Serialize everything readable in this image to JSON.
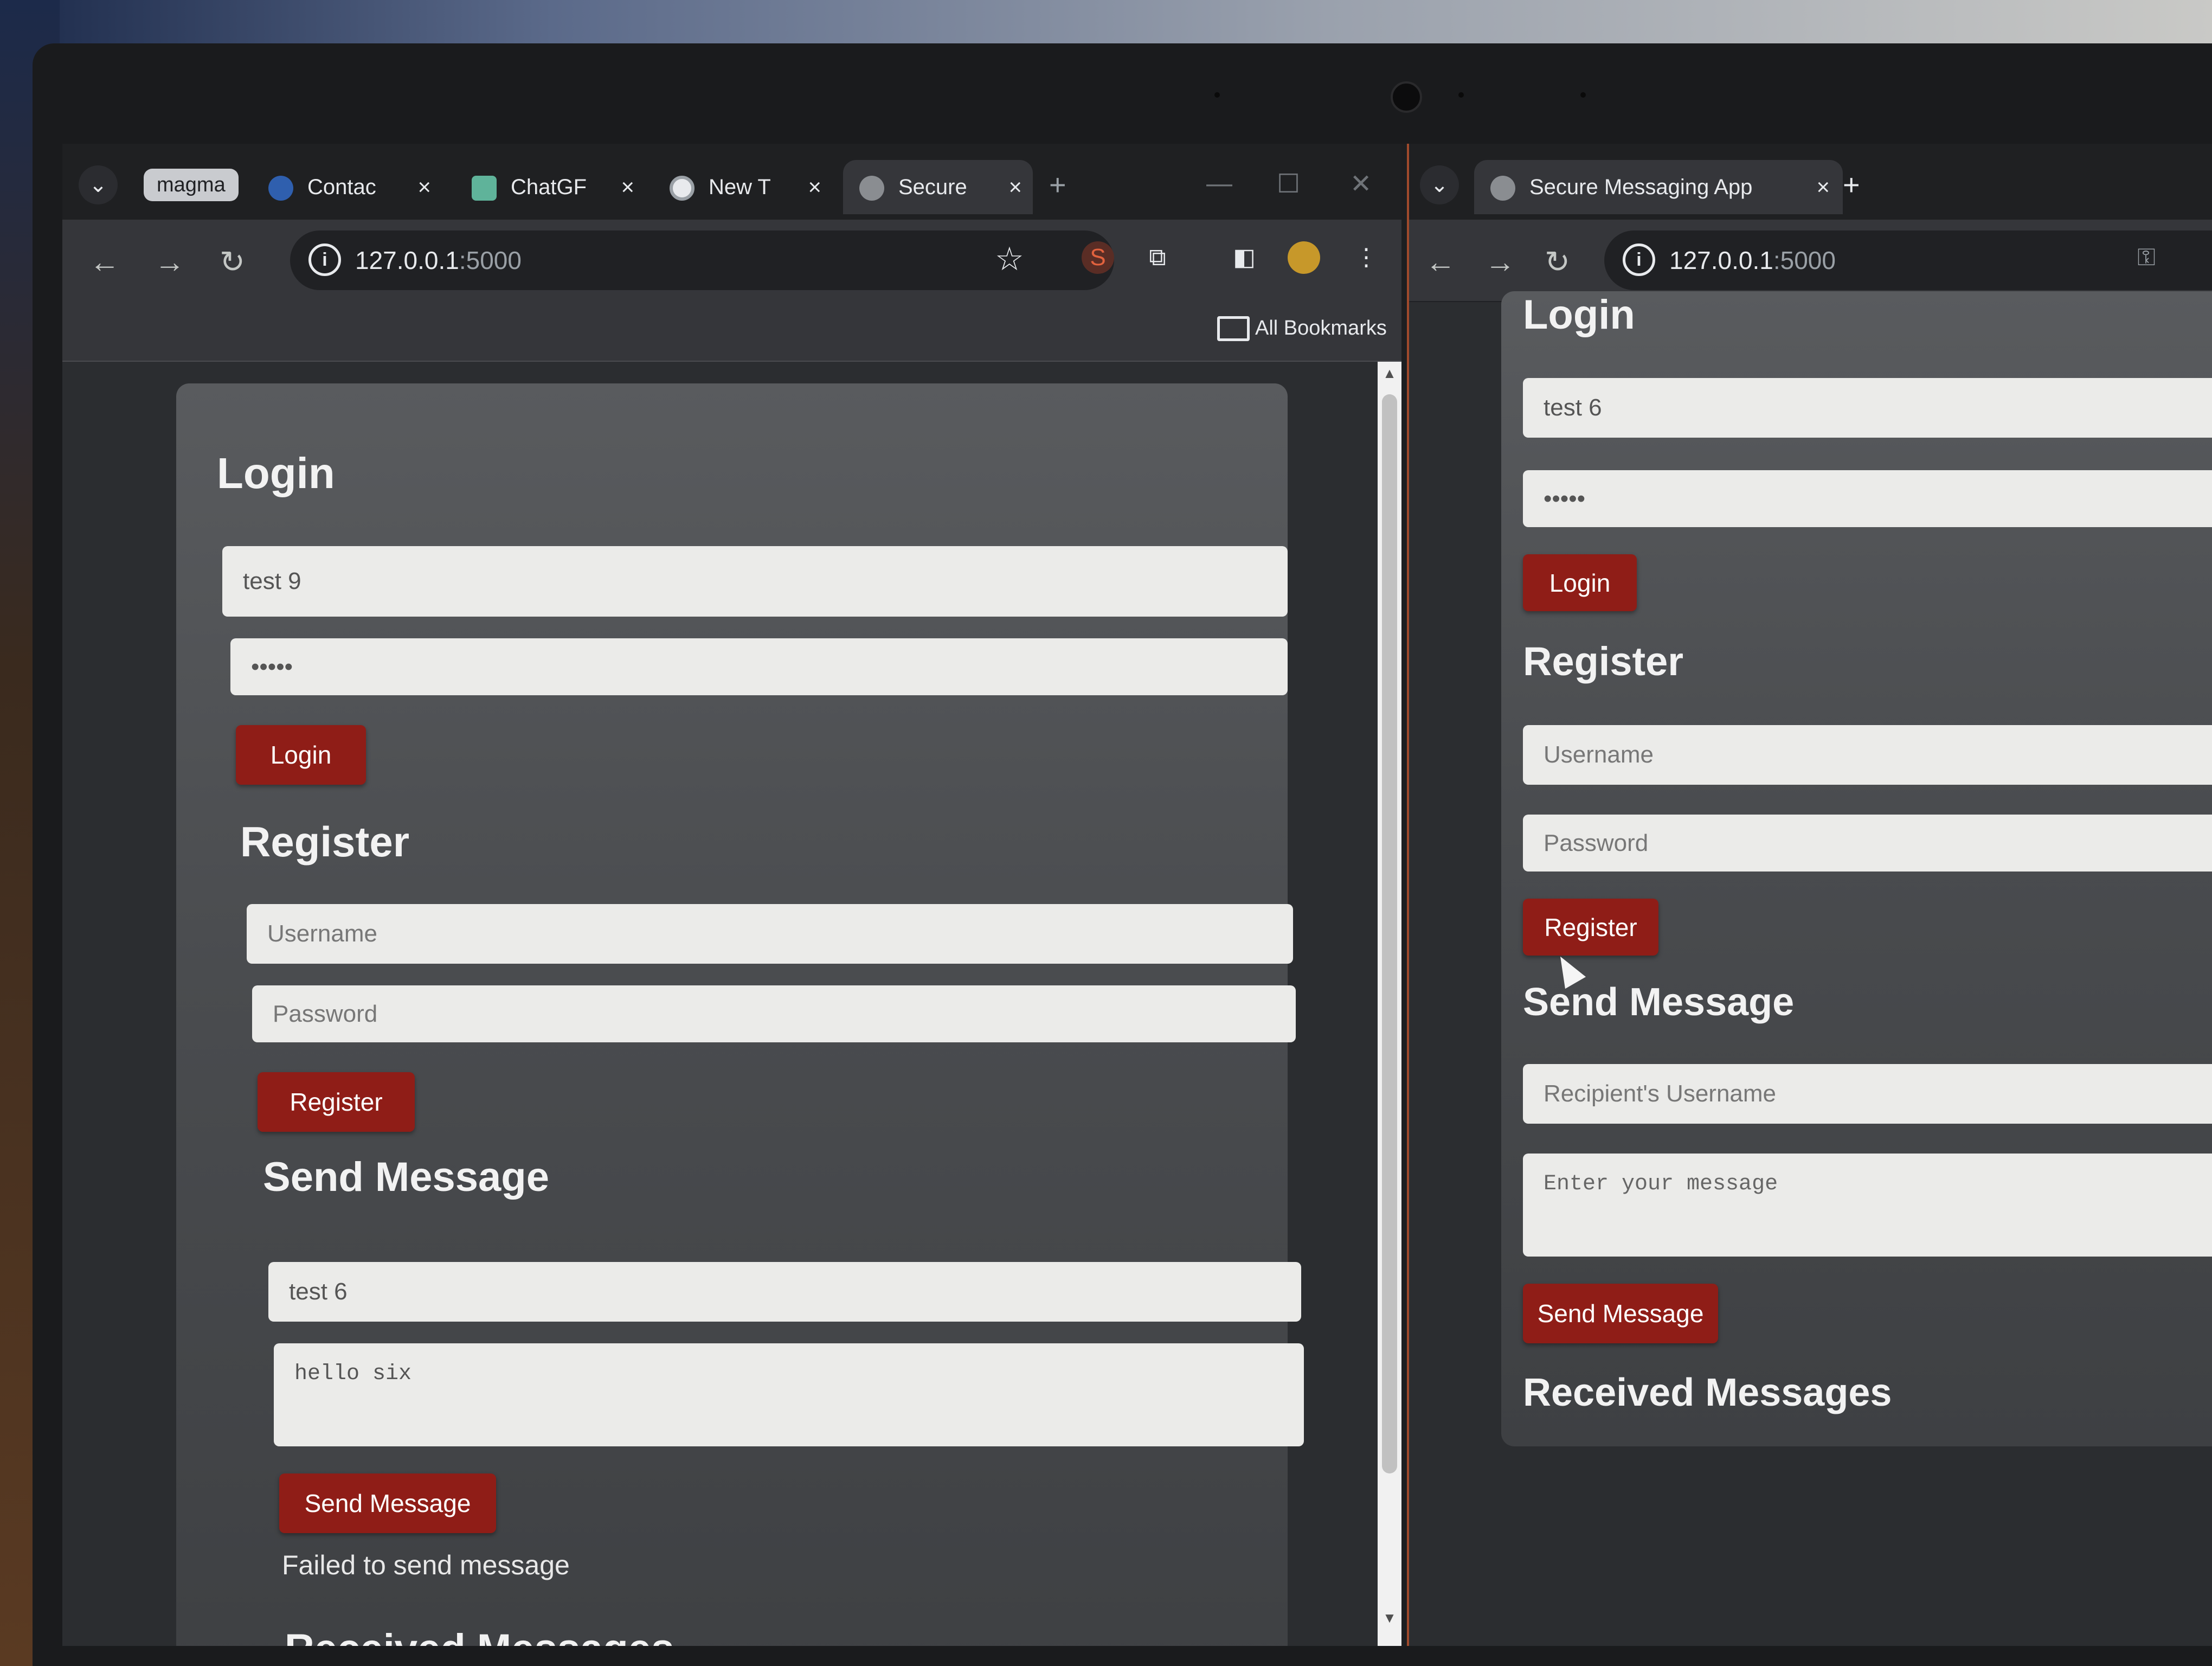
{
  "left_browser": {
    "tab_group": "magma",
    "tabs": [
      {
        "title": "Contac",
        "close": "×"
      },
      {
        "title": "ChatGF",
        "close": "×"
      },
      {
        "title": "New T",
        "close": "×"
      },
      {
        "title": "Secure",
        "close": "×"
      }
    ],
    "new_tab": "+",
    "window_controls": {
      "minimize": "—",
      "maximize": "☐",
      "close": "✕"
    },
    "url_host": "127.0.0.1",
    "url_port": ":5000",
    "bookmarks_label": "All Bookmarks",
    "page": {
      "login_heading": "Login",
      "login_username_value": "test 9",
      "login_password_value": "•••••",
      "login_button": "Login",
      "register_heading": "Register",
      "register_username_placeholder": "Username",
      "register_password_placeholder": "Password",
      "register_button": "Register",
      "send_heading": "Send Message",
      "recipient_value": "test 6",
      "message_value": "hello six",
      "send_button": "Send Message",
      "status_text": "Failed to send message",
      "received_heading": "Received Messages"
    }
  },
  "right_browser": {
    "tabs": [
      {
        "title": "Secure Messaging App",
        "close": "×"
      }
    ],
    "new_tab": "+",
    "url_host": "127.0.0.1",
    "url_port": ":5000",
    "page": {
      "login_heading": "Login",
      "login_username_value": "test 6",
      "login_password_value": "•••••",
      "login_button": "Login",
      "register_heading": "Register",
      "register_username_placeholder": "Username",
      "register_password_placeholder": "Password",
      "register_button": "Register",
      "send_heading": "Send Message",
      "recipient_placeholder": "Recipient's Username",
      "message_placeholder": "Enter your message",
      "send_button": "Send Message",
      "received_heading": "Received Messages"
    }
  },
  "icons": {
    "back": "back-arrow-icon",
    "forward": "forward-arrow-icon",
    "reload": "reload-icon",
    "site_info": "info-icon",
    "bookmark_star": "star-icon",
    "extensions": "puzzle-icon",
    "side_panel": "side-panel-icon",
    "profile": "avatar",
    "menu": "kebab-menu-icon"
  },
  "colors": {
    "button_red": "#8f1d17",
    "card_gray": "#4a4c4f",
    "field_bg": "#ebebe9",
    "chrome_dark": "#202124"
  }
}
